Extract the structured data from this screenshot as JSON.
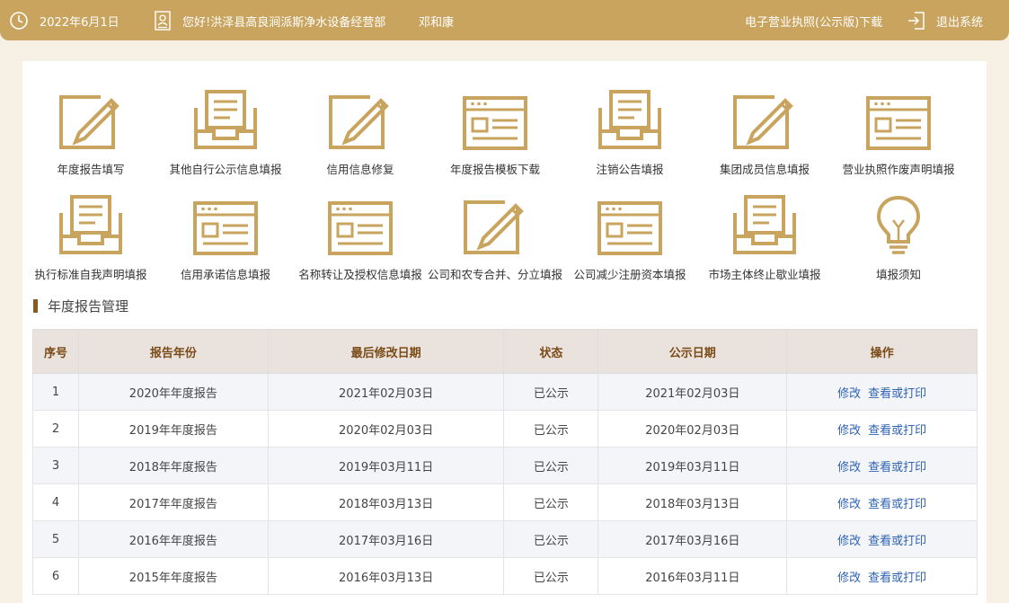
{
  "header": {
    "date": "2022年6月1日",
    "greeting": "您好!洪泽县高良涧派斯净水设备经营部",
    "person": "邓和康",
    "license_link": "电子营业执照(公示版)下载",
    "logout": "退出系统",
    "icons": [
      "clock-icon",
      "user-card-icon",
      "logout-icon"
    ],
    "bar_color": "#c9a45e"
  },
  "tiles": [
    {
      "label": "年度报告填写",
      "icon": "pencil-doc-icon"
    },
    {
      "label": "其他自行公示信息填报",
      "icon": "inbox-doc-icon"
    },
    {
      "label": "信用信息修复",
      "icon": "pencil-doc-icon"
    },
    {
      "label": "年度报告模板下载",
      "icon": "form-window-icon"
    },
    {
      "label": "注销公告填报",
      "icon": "inbox-doc-icon"
    },
    {
      "label": "集团成员信息填报",
      "icon": "pencil-doc-icon"
    },
    {
      "label": "营业执照作废声明填报",
      "icon": "form-window-icon"
    },
    {
      "label": "执行标准自我声明填报",
      "icon": "inbox-doc-icon"
    },
    {
      "label": "信用承诺信息填报",
      "icon": "form-window-icon"
    },
    {
      "label": "名称转让及授权信息填报",
      "icon": "form-window-icon"
    },
    {
      "label": "公司和农专合并、分立填报",
      "icon": "pencil-doc-icon"
    },
    {
      "label": "公司减少注册资本填报",
      "icon": "form-window-icon"
    },
    {
      "label": "市场主体终止歇业填报",
      "icon": "inbox-doc-icon"
    },
    {
      "label": "填报须知",
      "icon": "lightbulb-icon"
    }
  ],
  "section": {
    "title": "年度报告管理"
  },
  "table": {
    "headers": [
      "序号",
      "报告年份",
      "最后修改日期",
      "状态",
      "公示日期",
      "操作"
    ],
    "rows": [
      {
        "no": "1",
        "year": "2020年年度报告",
        "modified": "2021年02月03日",
        "status": "已公示",
        "published": "2021年02月03日",
        "edit": "修改",
        "view": "查看或打印"
      },
      {
        "no": "2",
        "year": "2019年年度报告",
        "modified": "2020年02月03日",
        "status": "已公示",
        "published": "2020年02月03日",
        "edit": "修改",
        "view": "查看或打印"
      },
      {
        "no": "3",
        "year": "2018年年度报告",
        "modified": "2019年03月11日",
        "status": "已公示",
        "published": "2019年03月11日",
        "edit": "修改",
        "view": "查看或打印"
      },
      {
        "no": "4",
        "year": "2017年年度报告",
        "modified": "2018年03月13日",
        "status": "已公示",
        "published": "2018年03月13日",
        "edit": "修改",
        "view": "查看或打印"
      },
      {
        "no": "5",
        "year": "2016年年度报告",
        "modified": "2017年03月16日",
        "status": "已公示",
        "published": "2017年03月16日",
        "edit": "修改",
        "view": "查看或打印"
      },
      {
        "no": "6",
        "year": "2015年年度报告",
        "modified": "2016年03月13日",
        "status": "已公示",
        "published": "2016年03月11日",
        "edit": "修改",
        "view": "查看或打印"
      }
    ]
  },
  "colors": {
    "gold": "#c9a45e",
    "link": "#2f63b4",
    "header_text": "#7a4b17"
  }
}
